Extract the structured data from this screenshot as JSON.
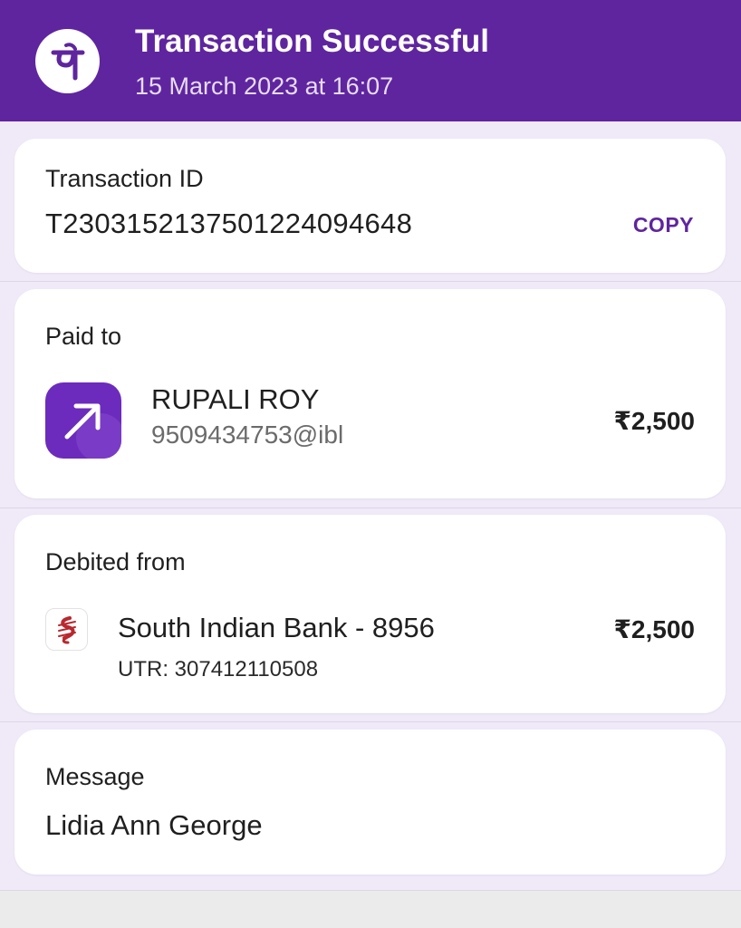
{
  "header": {
    "title": "Transaction Successful",
    "datetime": "15 March 2023 at 16:07",
    "logo_glyph": "पे",
    "logo_icon": "phonepe-logo-icon",
    "bg_color": "#5f259f"
  },
  "transaction": {
    "label": "Transaction ID",
    "id": "T2303152137501224094648",
    "copy_label": "COPY"
  },
  "paid_to": {
    "label": "Paid to",
    "name": "RUPALI ROY",
    "upi_id": "9509434753@ibl",
    "amount": "₹2,500",
    "icon": "arrow-up-right-icon"
  },
  "debited_from": {
    "label": "Debited from",
    "bank": "South Indian Bank - 8956",
    "utr": "UTR: 307412110508",
    "amount": "₹2,500",
    "icon": "south-indian-bank-logo-icon"
  },
  "message": {
    "label": "Message",
    "text": "Lidia Ann George"
  },
  "colors": {
    "accent": "#5f259f",
    "page_bg": "#ece6f6",
    "card_bg": "#ffffff"
  }
}
